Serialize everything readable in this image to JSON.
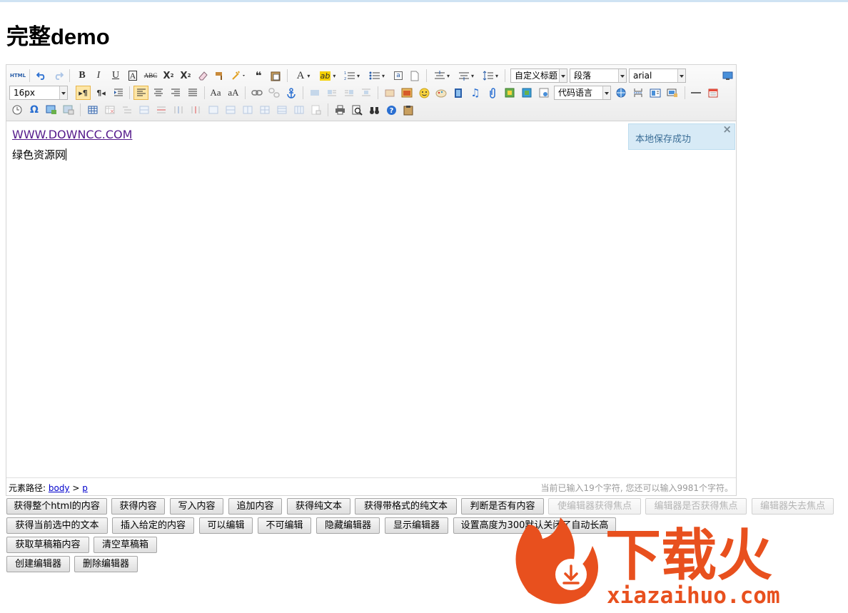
{
  "page": {
    "title": "完整demo"
  },
  "toolbar": {
    "source_label": "HTML",
    "custom_style": "自定义标题",
    "paragraph": "段落",
    "font_family": "arial",
    "font_size": "16px",
    "code_language": "代码语言"
  },
  "content": {
    "link_text": "WWW.DOWNCC.COM",
    "text_line": "绿色资源网"
  },
  "toast": {
    "message": "本地保存成功",
    "close": "×"
  },
  "status": {
    "path_label": "元素路径: ",
    "path_body": "body",
    "path_sep": " > ",
    "path_p": "p",
    "count_text": "当前已输入19个字符, 您还可以输入9981个字符。"
  },
  "buttons": {
    "row1": [
      "获得整个html的内容",
      "获得内容",
      "写入内容",
      "追加内容",
      "获得纯文本",
      "获得带格式的纯文本",
      "判断是否有内容",
      "使编辑器获得焦点",
      "编辑器是否获得焦点",
      "编辑器失去焦点"
    ],
    "row2": [
      "获得当前选中的文本",
      "插入给定的内容",
      "可以编辑",
      "不可编辑",
      "隐藏编辑器",
      "显示编辑器",
      "设置高度为300默认关闭了自动长高"
    ],
    "row3": [
      "获取草稿箱内容",
      "清空草稿箱"
    ],
    "row4": [
      "创建编辑器",
      "删除编辑器"
    ]
  },
  "watermark": {
    "brand": "下载火",
    "domain": "xiazaihuo.com"
  },
  "colors": {
    "toast_bg": "#d7eaf6",
    "link": "#551a8b",
    "watermark": "#e8501e"
  }
}
